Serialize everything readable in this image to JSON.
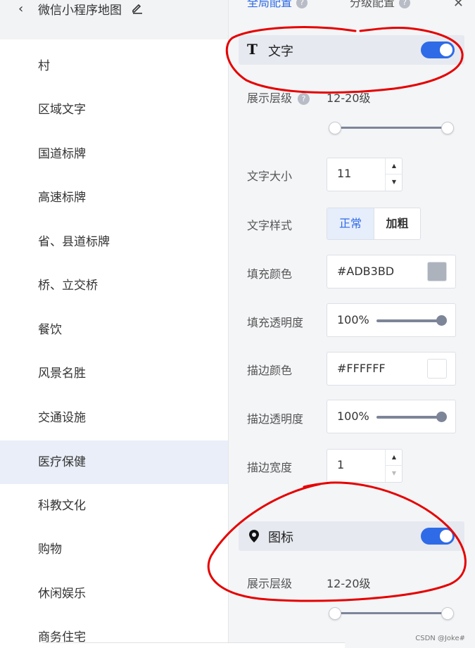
{
  "left_panel": {
    "title": "微信小程序地图",
    "items": [
      {
        "label": "村"
      },
      {
        "label": "区域文字"
      },
      {
        "label": "国道标牌"
      },
      {
        "label": "高速标牌"
      },
      {
        "label": "省、县道标牌"
      },
      {
        "label": "桥、立交桥"
      },
      {
        "label": "餐饮"
      },
      {
        "label": "风景名胜"
      },
      {
        "label": "交通设施"
      },
      {
        "label": "医疗保健",
        "active": true
      },
      {
        "label": "科教文化"
      },
      {
        "label": "购物"
      },
      {
        "label": "休闲娱乐"
      },
      {
        "label": "商务住宅"
      }
    ]
  },
  "tabs": {
    "global": "全局配置",
    "level": "分级配置"
  },
  "text_section": {
    "title": "文字",
    "icon": "text-T-icon",
    "enabled": true,
    "display_level_label": "展示层级",
    "display_level_value": "12-20级",
    "level_range": [
      12,
      20
    ],
    "font_size_label": "文字大小",
    "font_size_value": "11",
    "style_label": "文字样式",
    "style_normal": "正常",
    "style_bold": "加粗",
    "fill_color_label": "填充颜色",
    "fill_color_value": "#ADB3BD",
    "fill_color_swatch": "#ADB3BD",
    "fill_opacity_label": "填充透明度",
    "fill_opacity_value": "100%",
    "stroke_color_label": "描边颜色",
    "stroke_color_value": "#FFFFFF",
    "stroke_color_swatch": "#FFFFFF",
    "stroke_opacity_label": "描边透明度",
    "stroke_opacity_value": "100%",
    "stroke_width_label": "描边宽度",
    "stroke_width_value": "1"
  },
  "icon_section": {
    "title": "图标",
    "icon": "map-pin-icon",
    "enabled": true,
    "display_level_label": "展示层级",
    "display_level_value": "12-20级",
    "level_range": [
      12,
      20
    ]
  },
  "colors": {
    "accent": "#2F6BE7",
    "annotation": "#E60000"
  },
  "watermark": "CSDN @Joke#"
}
